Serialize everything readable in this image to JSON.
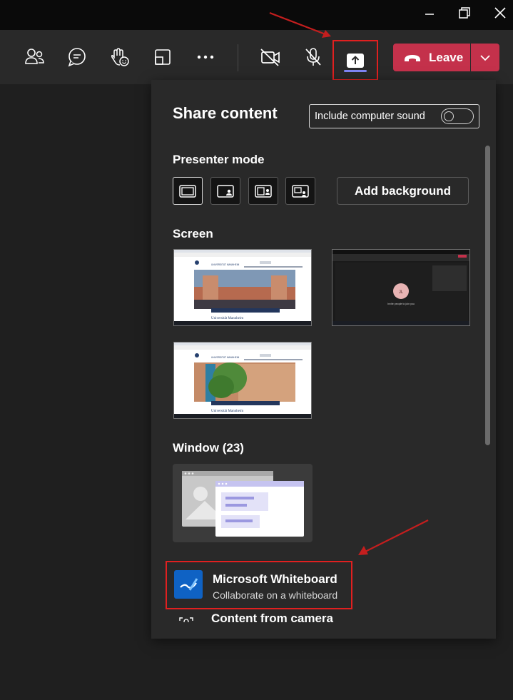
{
  "window": {
    "controls": [
      "minimize-icon",
      "restore-icon",
      "close-icon"
    ]
  },
  "toolbar": {
    "buttons": [
      "people-icon",
      "chat-icon",
      "raise-hand-icon",
      "view-icon",
      "more-icon",
      "camera-off-icon",
      "mic-off-icon",
      "share-icon"
    ],
    "leave_label": "Leave",
    "accent_color": "#c4314b"
  },
  "share_panel": {
    "title": "Share content",
    "include_sound_label": "Include computer sound",
    "include_sound_on": false,
    "presenter_mode_heading": "Presenter mode",
    "presenter_modes": [
      "content-only-icon",
      "standout-icon",
      "side-by-side-icon",
      "reporter-icon"
    ],
    "add_background_label": "Add background",
    "screen_heading": "Screen",
    "screen_1": {
      "brand": "UNIVERSITÄT MANNHEIM",
      "footer_name": "Universität Mannheim"
    },
    "screen_2": {
      "avatar_initials": "JL",
      "caption": "Invite people to join you"
    },
    "screen_3": {
      "brand": "UNIVERSITÄT MANNHEIM",
      "footer_name": "Universität Mannheim"
    },
    "window_heading": "Window (23)",
    "whiteboard_title": "Microsoft Whiteboard",
    "whiteboard_subtitle": "Collaborate on a whiteboard",
    "camera_title": "Content from camera"
  }
}
